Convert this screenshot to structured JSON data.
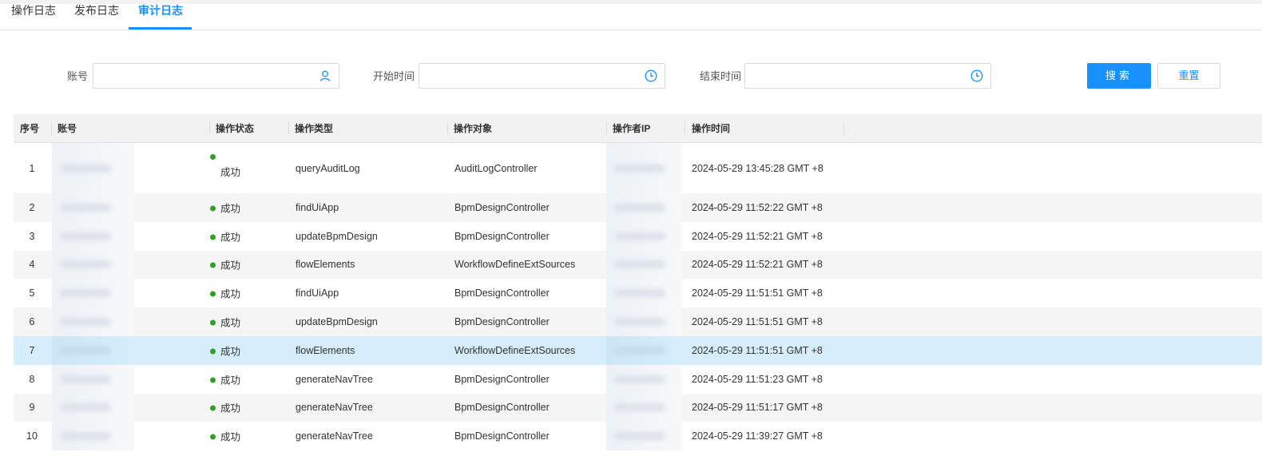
{
  "tabs": [
    {
      "label": "操作日志",
      "active": false
    },
    {
      "label": "发布日志",
      "active": false
    },
    {
      "label": "审计日志",
      "active": true
    }
  ],
  "search": {
    "account_label": "账号",
    "start_label": "开始时间",
    "end_label": "结束时间",
    "account_value": "",
    "start_value": "",
    "end_value": "",
    "search_button": "搜索",
    "reset_button": "重置"
  },
  "table": {
    "headers": {
      "index": "序号",
      "account": "账号",
      "status": "操作状态",
      "type": "操作类型",
      "target": "操作对象",
      "ip": "操作者IP",
      "time": "操作时间"
    },
    "rows": [
      {
        "index": "1",
        "status": "成功",
        "type": "queryAuditLog",
        "target": "AuditLogController",
        "time": "2024-05-29 13:45:28 GMT +8"
      },
      {
        "index": "2",
        "status": "成功",
        "type": "findUiApp",
        "target": "BpmDesignController",
        "time": "2024-05-29 11:52:22 GMT +8"
      },
      {
        "index": "3",
        "status": "成功",
        "type": "updateBpmDesign",
        "target": "BpmDesignController",
        "time": "2024-05-29 11:52:21 GMT +8"
      },
      {
        "index": "4",
        "status": "成功",
        "type": "flowElements",
        "target": "WorkflowDefineExtSources",
        "time": "2024-05-29 11:52:21 GMT +8"
      },
      {
        "index": "5",
        "status": "成功",
        "type": "findUiApp",
        "target": "BpmDesignController",
        "time": "2024-05-29 11:51:51 GMT +8"
      },
      {
        "index": "6",
        "status": "成功",
        "type": "updateBpmDesign",
        "target": "BpmDesignController",
        "time": "2024-05-29 11:51:51 GMT +8"
      },
      {
        "index": "7",
        "status": "成功",
        "type": "flowElements",
        "target": "WorkflowDefineExtSources",
        "time": "2024-05-29 11:51:51 GMT +8"
      },
      {
        "index": "8",
        "status": "成功",
        "type": "generateNavTree",
        "target": "BpmDesignController",
        "time": "2024-05-29 11:51:23 GMT +8"
      },
      {
        "index": "9",
        "status": "成功",
        "type": "generateNavTree",
        "target": "BpmDesignController",
        "time": "2024-05-29 11:51:17 GMT +8"
      },
      {
        "index": "10",
        "status": "成功",
        "type": "generateNavTree",
        "target": "BpmDesignController",
        "time": "2024-05-29 11:39:27 GMT +8"
      }
    ]
  },
  "colors": {
    "accent": "#1890ff",
    "success_dot": "#2ea121",
    "row_highlight": "#d6eefb",
    "row_alt": "#f5f5f5"
  },
  "icons": {
    "account_input": "user-icon",
    "start_input": "clock-icon",
    "end_input": "clock-icon",
    "status": "status-dot-icon"
  }
}
